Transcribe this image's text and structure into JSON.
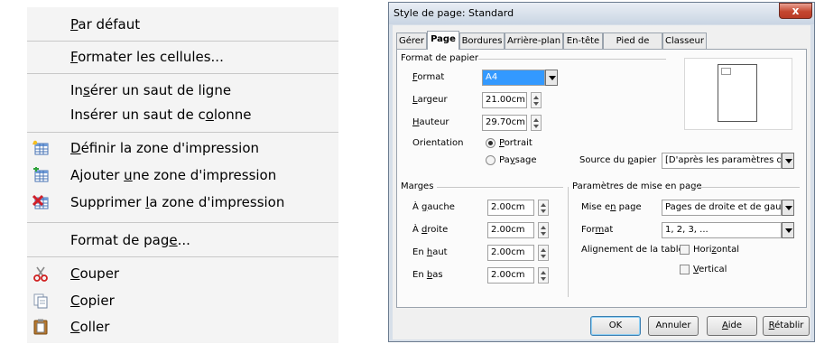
{
  "context_menu": {
    "items": {
      "default": [
        "",
        "P",
        "ar défaut"
      ],
      "format_cells": [
        "",
        "F",
        "ormater les cellules..."
      ],
      "insert_row_break": [
        "In",
        "s",
        "érer un saut de ligne"
      ],
      "insert_col_break": [
        "Insérer un saut de c",
        "o",
        "lonne"
      ],
      "define_print_range": [
        "",
        "D",
        "éfinir la zone d'impression"
      ],
      "add_print_range": [
        "Ajouter ",
        "u",
        "ne zone d'impression"
      ],
      "delete_print_range": [
        "Supprimer ",
        "l",
        "a zone d'impression"
      ],
      "page_format": [
        "Format de pag",
        "e",
        "..."
      ],
      "cut": [
        "",
        "C",
        "ouper"
      ],
      "copy": [
        "",
        "C",
        "opier"
      ],
      "paste": [
        "",
        "C",
        "oller"
      ]
    }
  },
  "dialog": {
    "title": "Style de page: Standard",
    "close_glyph": "x",
    "tabs": [
      "Gérer",
      "Page",
      "Bordures",
      "Arrière-plan",
      "En-tête",
      "Pied de page",
      "Classeur"
    ],
    "paper": {
      "section": "Format de papier",
      "format_label": [
        "",
        "F",
        "ormat"
      ],
      "format_value": "A4",
      "width_label": [
        "",
        "L",
        "argeur"
      ],
      "width_value": "21.00cm",
      "height_label": [
        "",
        "H",
        "auteur"
      ],
      "height_value": "29.70cm",
      "orientation_label": "Orientation",
      "portrait_label": [
        "",
        "P",
        "ortrait"
      ],
      "landscape_label": [
        "Pa",
        "y",
        "sage"
      ],
      "paper_source_label": [
        "Source du ",
        "p",
        "apier"
      ],
      "paper_source_value": "[D'après les paramètres de l'"
    },
    "margins": {
      "section": "Marges",
      "left_label": [
        "À ",
        "g",
        "auche"
      ],
      "left_value": "2.00cm",
      "right_label": [
        "À ",
        "d",
        "roite"
      ],
      "right_value": "2.00cm",
      "top_label": [
        "En ",
        "h",
        "aut"
      ],
      "top_value": "2.00cm",
      "bottom_label": [
        "En ",
        "b",
        "as"
      ],
      "bottom_value": "2.00cm"
    },
    "layout": {
      "section": "Paramètres de mise en page",
      "page_layout_label": [
        "Mise e",
        "n",
        " page"
      ],
      "page_layout_value": "Pages de droite et de gauc",
      "numbering_label": [
        "For",
        "m",
        "at"
      ],
      "numbering_value": "1, 2, 3, ...",
      "table_align_label": "Alignement de la table",
      "horizontal_label": [
        "Hori",
        "z",
        "ontal"
      ],
      "vertical_label": [
        "",
        "V",
        "ertical"
      ]
    },
    "buttons": {
      "ok": [
        "",
        "",
        "OK"
      ],
      "cancel": [
        "",
        "",
        "Annuler"
      ],
      "help": [
        "",
        "A",
        "ide"
      ],
      "reset": [
        "",
        "R",
        "établir"
      ]
    }
  }
}
